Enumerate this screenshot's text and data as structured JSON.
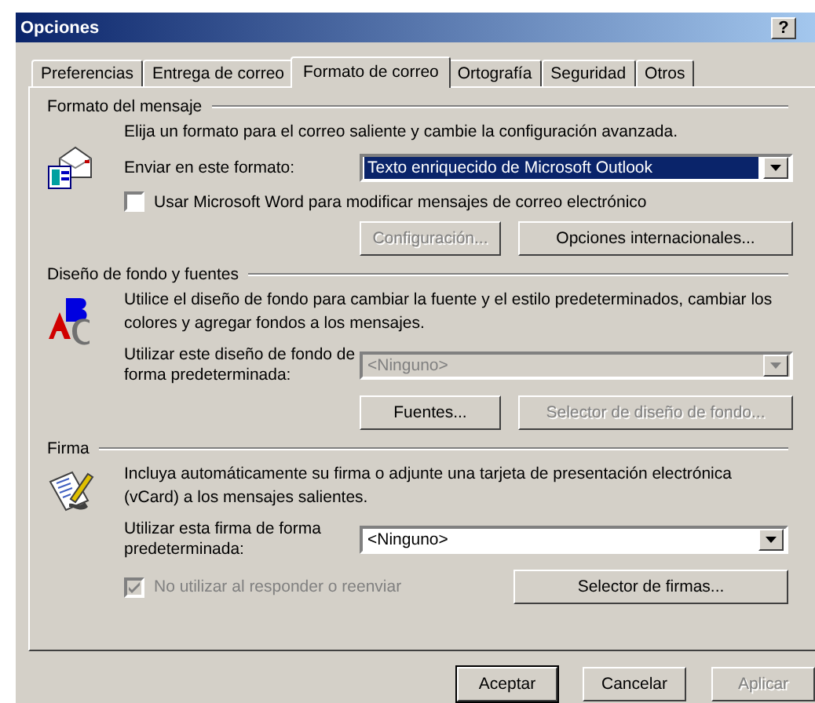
{
  "window": {
    "title": "Opciones",
    "help_button": "?"
  },
  "tabs": [
    {
      "label": "Preferencias",
      "selected": false
    },
    {
      "label": "Entrega de correo",
      "selected": false
    },
    {
      "label": "Formato de correo",
      "selected": true
    },
    {
      "label": "Ortografía",
      "selected": false
    },
    {
      "label": "Seguridad",
      "selected": false
    },
    {
      "label": "Otros",
      "selected": false
    }
  ],
  "message_format": {
    "title": "Formato del mensaje",
    "description": "Elija un formato para el correo saliente y cambie la configuración avanzada.",
    "select_label": "Enviar en este formato:",
    "select_value": "Texto enriquecido de Microsoft Outlook",
    "select_highlighted": true,
    "checkbox": {
      "label": "Usar Microsoft Word para modificar mensajes de correo electrónico",
      "checked": false,
      "disabled": false
    },
    "buttons": [
      {
        "label": "Configuración...",
        "disabled": true
      },
      {
        "label": "Opciones internacionales...",
        "disabled": false
      }
    ]
  },
  "stationery": {
    "title": "Diseño de fondo y fuentes",
    "description": "Utilice el diseño de fondo para cambiar la fuente y el estilo predeterminados, cambiar los colores y agregar fondos a los mensajes.",
    "select_label": "Utilizar este diseño de fondo de forma predeterminada:",
    "select_value": "<Ninguno>",
    "select_disabled": true,
    "buttons": [
      {
        "label": "Fuentes...",
        "disabled": false
      },
      {
        "label": "Selector de diseño de fondo...",
        "disabled": true
      }
    ]
  },
  "signature": {
    "title": "Firma",
    "description": "Incluya automáticamente su firma o adjunte una tarjeta de presentación electrónica (vCard) a los mensajes salientes.",
    "select_label": "Utilizar esta firma de forma predeterminada:",
    "select_value": "<Ninguno>",
    "select_disabled": false,
    "checkbox": {
      "label": "No utilizar al responder o reenviar",
      "checked": true,
      "disabled": true
    },
    "buttons": [
      {
        "label": "Selector de firmas...",
        "disabled": false
      }
    ]
  },
  "footer_buttons": [
    {
      "label": "Aceptar",
      "disabled": false,
      "default": true
    },
    {
      "label": "Cancelar",
      "disabled": false,
      "default": false
    },
    {
      "label": "Aplicar",
      "disabled": true,
      "default": false
    }
  ]
}
